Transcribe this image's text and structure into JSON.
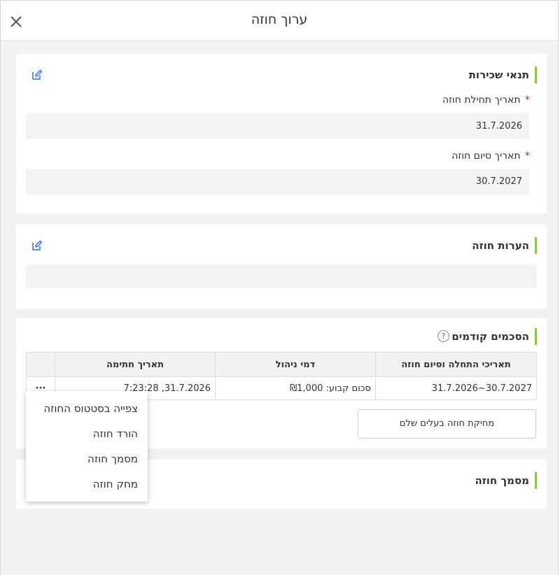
{
  "dialog": {
    "title": "ערוך חוזה"
  },
  "rental_terms": {
    "title": "תנאי שכירות",
    "start_label": "תאריך תחילת חוזה",
    "start_value": "31.7.2026",
    "end_label": "תאריך סיום חוזה",
    "end_value": "30.7.2027",
    "required_mark": "*"
  },
  "notes": {
    "title": "הערות חוזה",
    "value": ""
  },
  "previous_agreements": {
    "title": "הסכמים קודמים",
    "help_symbol": "?",
    "columns": [
      "תאריכי התחלה וסיום חוזה",
      "דמי ניהול",
      "תאריך חתימה"
    ],
    "rows": [
      {
        "dates": "30.7.2027~31.7.2026",
        "fee": "סכום קבוע: ₪1,000",
        "signed": "31.7.2026, 7:23:28"
      }
    ],
    "row_menu_symbol": "···",
    "delete_owner_button": "מחיקת חוזה בעלים שלם"
  },
  "contract_document": {
    "title": "מסמך חוזה"
  },
  "context_menu": {
    "items": [
      "צפייה בסטטוס החוזה",
      "הורד חוזה",
      "מסמך חוזה",
      "מחק חוזה"
    ]
  },
  "colors": {
    "accent": "#8bc34a",
    "edit_icon": "#2f6fd0",
    "required": "#e02020"
  }
}
